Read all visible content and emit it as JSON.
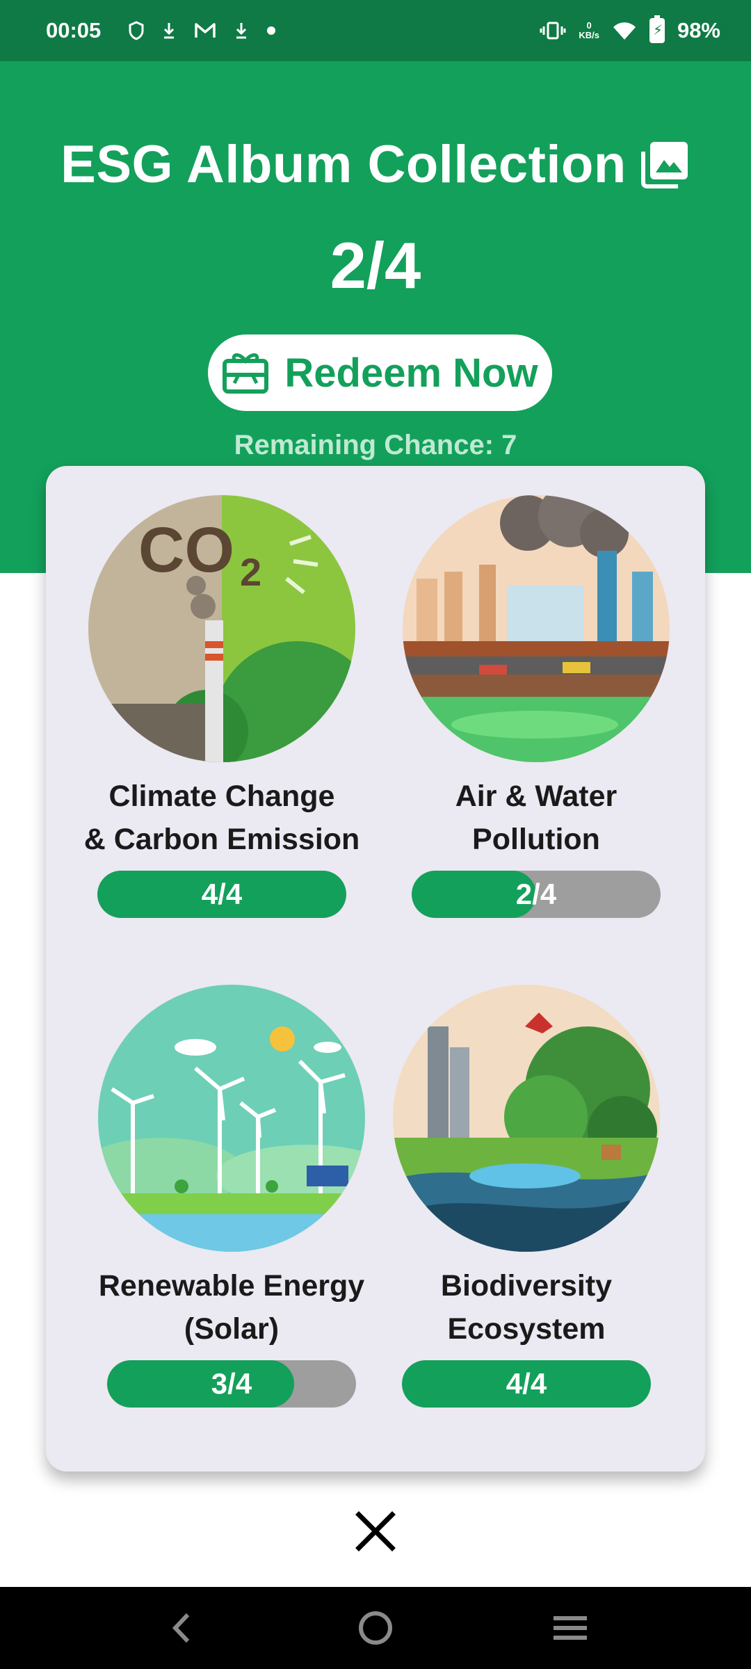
{
  "status_bar": {
    "time": "00:05",
    "net_speed_value": "0",
    "net_speed_unit": "KB/s",
    "battery": "98%",
    "icons": [
      "shield-icon",
      "download-icon",
      "gmail-icon",
      "download-icon",
      "dot-icon",
      "vibrate-icon",
      "wifi-icon",
      "battery-charging-icon"
    ]
  },
  "header": {
    "title": "ESG Album Collection",
    "title_icon": "photo-album-icon",
    "count": "2/4",
    "redeem_label": "Redeem Now",
    "redeem_icon": "gift-card-icon",
    "remaining": "Remaining Chance: 7"
  },
  "albums": [
    {
      "name_line1": "Climate Change",
      "name_line2": "& Carbon Emission",
      "progress": "4/4",
      "collected": 4,
      "total": 4
    },
    {
      "name_line1": "Air & Water",
      "name_line2": "Pollution",
      "progress": "2/4",
      "collected": 2,
      "total": 4
    },
    {
      "name_line1": "Renewable Energy",
      "name_line2": "(Solar)",
      "progress": "3/4",
      "collected": 3,
      "total": 4
    },
    {
      "name_line1": "Biodiversity",
      "name_line2": "Ecosystem",
      "progress": "4/4",
      "collected": 4,
      "total": 4
    }
  ],
  "colors": {
    "primary": "#13a05b",
    "status_bar": "#0f7a45",
    "card_bg": "#ebe9f1",
    "progress_track": "#9e9e9e"
  },
  "close_icon": "close-icon",
  "nav": [
    "back-icon",
    "home-icon",
    "menu-icon"
  ]
}
